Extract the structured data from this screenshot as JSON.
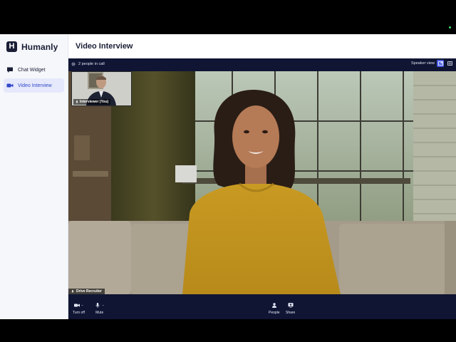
{
  "brand": {
    "name": "Humanly",
    "mark": "H"
  },
  "sidebar": {
    "items": [
      {
        "label": "Chat Widget",
        "icon": "chat-bubble-icon",
        "active": false
      },
      {
        "label": "Video Interview",
        "icon": "video-camera-icon",
        "active": true
      }
    ]
  },
  "page": {
    "title": "Video Interview"
  },
  "call": {
    "people_count": "2 people in call",
    "view_label": "Speaker view",
    "self_tile_label": "Interviewer (You)",
    "speaker_label": "Drive Recruiter"
  },
  "controls": {
    "camera_label": "Turn off",
    "mute_label": "Mute",
    "people_label": "People",
    "share_label": "Share"
  },
  "colors": {
    "call_bg": "#0f1533",
    "accent": "#4a5ee8",
    "nav_active_bg": "#e6e9fb",
    "nav_active_text": "#3048c9",
    "brand_dark": "#1a1f36"
  }
}
